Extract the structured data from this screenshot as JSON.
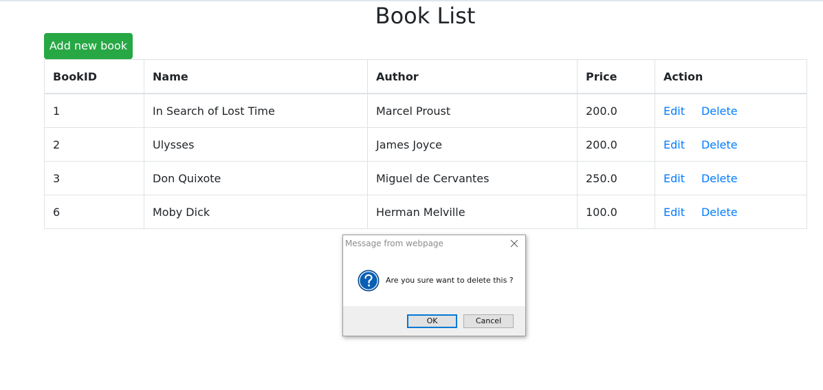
{
  "page": {
    "title": "Book List",
    "add_button": "Add new book"
  },
  "table": {
    "headers": [
      "BookID",
      "Name",
      "Author",
      "Price",
      "Action"
    ],
    "rows": [
      {
        "id": "1",
        "name": "In Search of Lost Time",
        "author": "Marcel Proust",
        "price": "200.0",
        "edit": "Edit",
        "delete": "Delete"
      },
      {
        "id": "2",
        "name": "Ulysses",
        "author": "James Joyce",
        "price": "200.0",
        "edit": "Edit",
        "delete": "Delete"
      },
      {
        "id": "3",
        "name": "Don Quixote",
        "author": "Miguel de Cervantes",
        "price": "250.0",
        "edit": "Edit",
        "delete": "Delete"
      },
      {
        "id": "6",
        "name": "Moby Dick",
        "author": "Herman Melville",
        "price": "100.0",
        "edit": "Edit",
        "delete": "Delete"
      }
    ]
  },
  "dialog": {
    "title": "Message from webpage",
    "message": "Are you sure want to delete this ?",
    "ok_label": "OK",
    "cancel_label": "Cancel",
    "icon": "question-icon",
    "close_icon": "close-icon"
  },
  "colors": {
    "add_button": "#28a745",
    "link": "#007bff",
    "dialog_icon": "#0a5fb4",
    "ok_border": "#0078d7"
  }
}
